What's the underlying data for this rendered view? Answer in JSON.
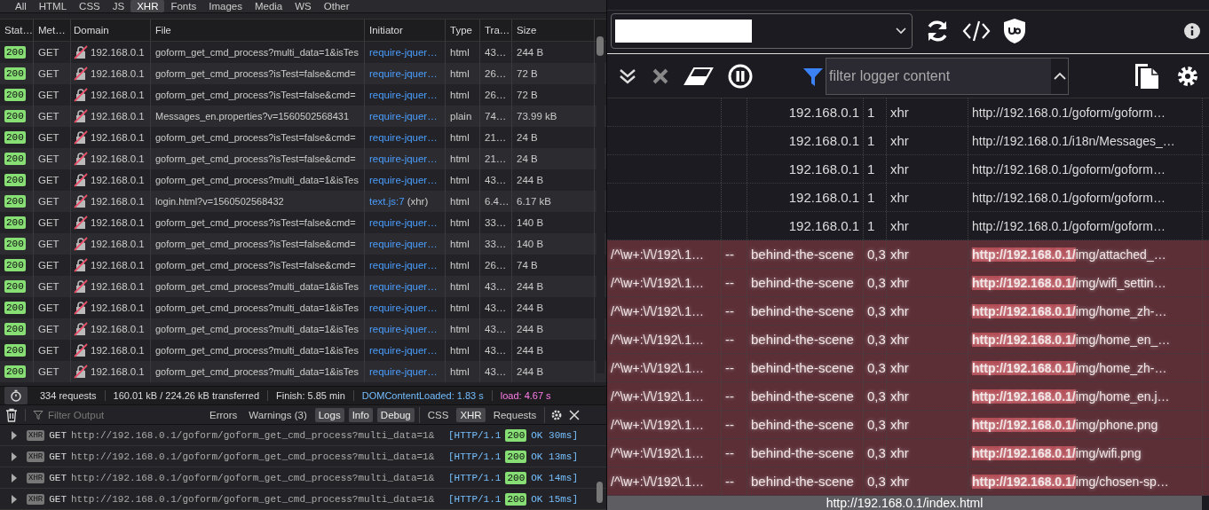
{
  "filter_tabs": [
    {
      "label": "All",
      "selected": false
    },
    {
      "label": "HTML",
      "selected": false
    },
    {
      "label": "CSS",
      "selected": false
    },
    {
      "label": "JS",
      "selected": false
    },
    {
      "label": "XHR",
      "selected": true
    },
    {
      "label": "Fonts",
      "selected": false
    },
    {
      "label": "Images",
      "selected": false
    },
    {
      "label": "Media",
      "selected": false
    },
    {
      "label": "WS",
      "selected": false
    },
    {
      "label": "Other",
      "selected": false
    }
  ],
  "network": {
    "columns": [
      "Stat…",
      "Met…",
      "Domain",
      "File",
      "Initiator",
      "Type",
      "Tra…",
      "Size"
    ],
    "rows": [
      {
        "status": "200",
        "method": "GET",
        "domain": "192.168.0.1",
        "file": "goform_get_cmd_process?multi_data=1&isTes",
        "initiator": "require-jquer…",
        "type": "html",
        "transferred": "43…",
        "size": "244 B"
      },
      {
        "status": "200",
        "method": "GET",
        "domain": "192.168.0.1",
        "file": "goform_get_cmd_process?isTest=false&cmd=",
        "initiator": "require-jquer…",
        "type": "html",
        "transferred": "26…",
        "size": "72 B"
      },
      {
        "status": "200",
        "method": "GET",
        "domain": "192.168.0.1",
        "file": "goform_get_cmd_process?isTest=false&cmd=",
        "initiator": "require-jquer…",
        "type": "html",
        "transferred": "26…",
        "size": "72 B"
      },
      {
        "status": "200",
        "method": "GET",
        "domain": "192.168.0.1",
        "file": "Messages_en.properties?v=1560502568431",
        "initiator": "require-jquer…",
        "type": "plain",
        "transferred": "74…",
        "size": "73.99 kB"
      },
      {
        "status": "200",
        "method": "GET",
        "domain": "192.168.0.1",
        "file": "goform_get_cmd_process?isTest=false&cmd=",
        "initiator": "require-jquer…",
        "type": "html",
        "transferred": "21…",
        "size": "24 B"
      },
      {
        "status": "200",
        "method": "GET",
        "domain": "192.168.0.1",
        "file": "goform_get_cmd_process?isTest=false&cmd=",
        "initiator": "require-jquer…",
        "type": "html",
        "transferred": "21…",
        "size": "24 B"
      },
      {
        "status": "200",
        "method": "GET",
        "domain": "192.168.0.1",
        "file": "goform_get_cmd_process?multi_data=1&isTes",
        "initiator": "require-jquer…",
        "type": "html",
        "transferred": "43…",
        "size": "244 B"
      },
      {
        "status": "200",
        "method": "GET",
        "domain": "192.168.0.1",
        "file": "login.html?v=1560502568432",
        "initiator": "text.js:7",
        "initiator_note": "(xhr)",
        "type": "html",
        "transferred": "6.4…",
        "size": "6.17 kB"
      },
      {
        "status": "200",
        "method": "GET",
        "domain": "192.168.0.1",
        "file": "goform_get_cmd_process?isTest=false&cmd=",
        "initiator": "require-jquer…",
        "type": "html",
        "transferred": "33…",
        "size": "140 B"
      },
      {
        "status": "200",
        "method": "GET",
        "domain": "192.168.0.1",
        "file": "goform_get_cmd_process?isTest=false&cmd=",
        "initiator": "require-jquer…",
        "type": "html",
        "transferred": "33…",
        "size": "140 B"
      },
      {
        "status": "200",
        "method": "GET",
        "domain": "192.168.0.1",
        "file": "goform_get_cmd_process?isTest=false&cmd=",
        "initiator": "require-jquer…",
        "type": "html",
        "transferred": "26…",
        "size": "74 B"
      },
      {
        "status": "200",
        "method": "GET",
        "domain": "192.168.0.1",
        "file": "goform_get_cmd_process?multi_data=1&isTes",
        "initiator": "require-jquer…",
        "type": "html",
        "transferred": "43…",
        "size": "244 B"
      },
      {
        "status": "200",
        "method": "GET",
        "domain": "192.168.0.1",
        "file": "goform_get_cmd_process?multi_data=1&isTes",
        "initiator": "require-jquer…",
        "type": "html",
        "transferred": "43…",
        "size": "244 B"
      },
      {
        "status": "200",
        "method": "GET",
        "domain": "192.168.0.1",
        "file": "goform_get_cmd_process?multi_data=1&isTes",
        "initiator": "require-jquer…",
        "type": "html",
        "transferred": "43…",
        "size": "244 B"
      },
      {
        "status": "200",
        "method": "GET",
        "domain": "192.168.0.1",
        "file": "goform_get_cmd_process?multi_data=1&isTes",
        "initiator": "require-jquer…",
        "type": "html",
        "transferred": "43…",
        "size": "244 B"
      },
      {
        "status": "200",
        "method": "GET",
        "domain": "192.168.0.1",
        "file": "goform_get_cmd_process?multi_data=1&isTes",
        "initiator": "require-jquer…",
        "type": "html",
        "transferred": "43…",
        "size": "244 B"
      }
    ]
  },
  "summary": {
    "requests": "334 requests",
    "transferred": "160.01 kB / 224.26 kB transferred",
    "finish": "Finish: 5.85 min",
    "dom_content_loaded": "DOMContentLoaded: 1.83 s",
    "load": "load: 4.67 s"
  },
  "console": {
    "filter_placeholder": "Filter Output",
    "levels": [
      {
        "label": "Errors",
        "selected": false
      },
      {
        "label": "Warnings (3)",
        "selected": false
      },
      {
        "label": "Logs",
        "selected": true
      },
      {
        "label": "Info",
        "selected": true
      },
      {
        "label": "Debug",
        "selected": true
      }
    ],
    "sources": [
      {
        "label": "CSS",
        "selected": false
      },
      {
        "label": "XHR",
        "selected": true
      },
      {
        "label": "Requests",
        "selected": false
      }
    ],
    "messages": [
      {
        "badge": "XHR",
        "method": "GET",
        "url": "http://192.168.0.1/goform/goform_get_cmd_process?multi_data=1&",
        "protocol": "[HTTP/1.1",
        "status": "200",
        "result": "OK 30ms]"
      },
      {
        "badge": "XHR",
        "method": "GET",
        "url": "http://192.168.0.1/goform/goform_get_cmd_process?multi_data=1&",
        "protocol": "[HTTP/1.1",
        "status": "200",
        "result": "OK 13ms]"
      },
      {
        "badge": "XHR",
        "method": "GET",
        "url": "http://192.168.0.1/goform/goform_get_cmd_process?multi_data=1&",
        "protocol": "[HTTP/1.1",
        "status": "200",
        "result": "OK 14ms]"
      },
      {
        "badge": "XHR",
        "method": "GET",
        "url": "http://192.168.0.1/goform/goform_get_cmd_process?multi_data=1&",
        "protocol": "[HTTP/1.1",
        "status": "200",
        "result": "OK 15ms]"
      }
    ]
  },
  "logger": {
    "filter_placeholder": "filter logger content",
    "rows": [
      {
        "kind": "allowed",
        "context": "192.168.0.1",
        "count": "1",
        "type": "xhr",
        "url": "http://192.168.0.1/goform/goform…"
      },
      {
        "kind": "allowed",
        "context": "192.168.0.1",
        "count": "1",
        "type": "xhr",
        "url": "http://192.168.0.1/i18n/Messages_…"
      },
      {
        "kind": "allowed",
        "context": "192.168.0.1",
        "count": "1",
        "type": "xhr",
        "url": "http://192.168.0.1/goform/goform…"
      },
      {
        "kind": "allowed",
        "context": "192.168.0.1",
        "count": "1",
        "type": "xhr",
        "url": "http://192.168.0.1/goform/goform…"
      },
      {
        "kind": "allowed",
        "context": "192.168.0.1",
        "count": "1",
        "type": "xhr",
        "url": "http://192.168.0.1/goform/goform…"
      },
      {
        "kind": "blocked",
        "filter": "/^\\w+:\\/\\/192\\.1…",
        "mark": "--",
        "context": "behind-the-scene",
        "count": "0,3",
        "type": "xhr",
        "url_match": "http://192.168.0.1/",
        "url_rest": "img/attached_…"
      },
      {
        "kind": "blocked",
        "filter": "/^\\w+:\\/\\/192\\.1…",
        "mark": "--",
        "context": "behind-the-scene",
        "count": "0,3",
        "type": "xhr",
        "url_match": "http://192.168.0.1/",
        "url_rest": "img/wifi_settin…"
      },
      {
        "kind": "blocked",
        "filter": "/^\\w+:\\/\\/192\\.1…",
        "mark": "--",
        "context": "behind-the-scene",
        "count": "0,3",
        "type": "xhr",
        "url_match": "http://192.168.0.1/",
        "url_rest": "img/home_zh-…"
      },
      {
        "kind": "blocked",
        "filter": "/^\\w+:\\/\\/192\\.1…",
        "mark": "--",
        "context": "behind-the-scene",
        "count": "0,3",
        "type": "xhr",
        "url_match": "http://192.168.0.1/",
        "url_rest": "img/home_en_…"
      },
      {
        "kind": "blocked",
        "filter": "/^\\w+:\\/\\/192\\.1…",
        "mark": "--",
        "context": "behind-the-scene",
        "count": "0,3",
        "type": "xhr",
        "url_match": "http://192.168.0.1/",
        "url_rest": "img/home_zh-…"
      },
      {
        "kind": "blocked",
        "filter": "/^\\w+:\\/\\/192\\.1…",
        "mark": "--",
        "context": "behind-the-scene",
        "count": "0,3",
        "type": "xhr",
        "url_match": "http://192.168.0.1/",
        "url_rest": "img/home_en.j…"
      },
      {
        "kind": "blocked",
        "filter": "/^\\w+:\\/\\/192\\.1…",
        "mark": "--",
        "context": "behind-the-scene",
        "count": "0,3",
        "type": "xhr",
        "url_match": "http://192.168.0.1/",
        "url_rest": "img/phone.png"
      },
      {
        "kind": "blocked",
        "filter": "/^\\w+:\\/\\/192\\.1…",
        "mark": "--",
        "context": "behind-the-scene",
        "count": "0,3",
        "type": "xhr",
        "url_match": "http://192.168.0.1/",
        "url_rest": "img/wifi.png"
      },
      {
        "kind": "blocked",
        "filter": "/^\\w+:\\/\\/192\\.1…",
        "mark": "--",
        "context": "behind-the-scene",
        "count": "0,3",
        "type": "xhr",
        "url_match": "http://192.168.0.1/",
        "url_rest": "img/chosen-sp…"
      }
    ],
    "footer": "http://192.168.0.1/index.html"
  }
}
